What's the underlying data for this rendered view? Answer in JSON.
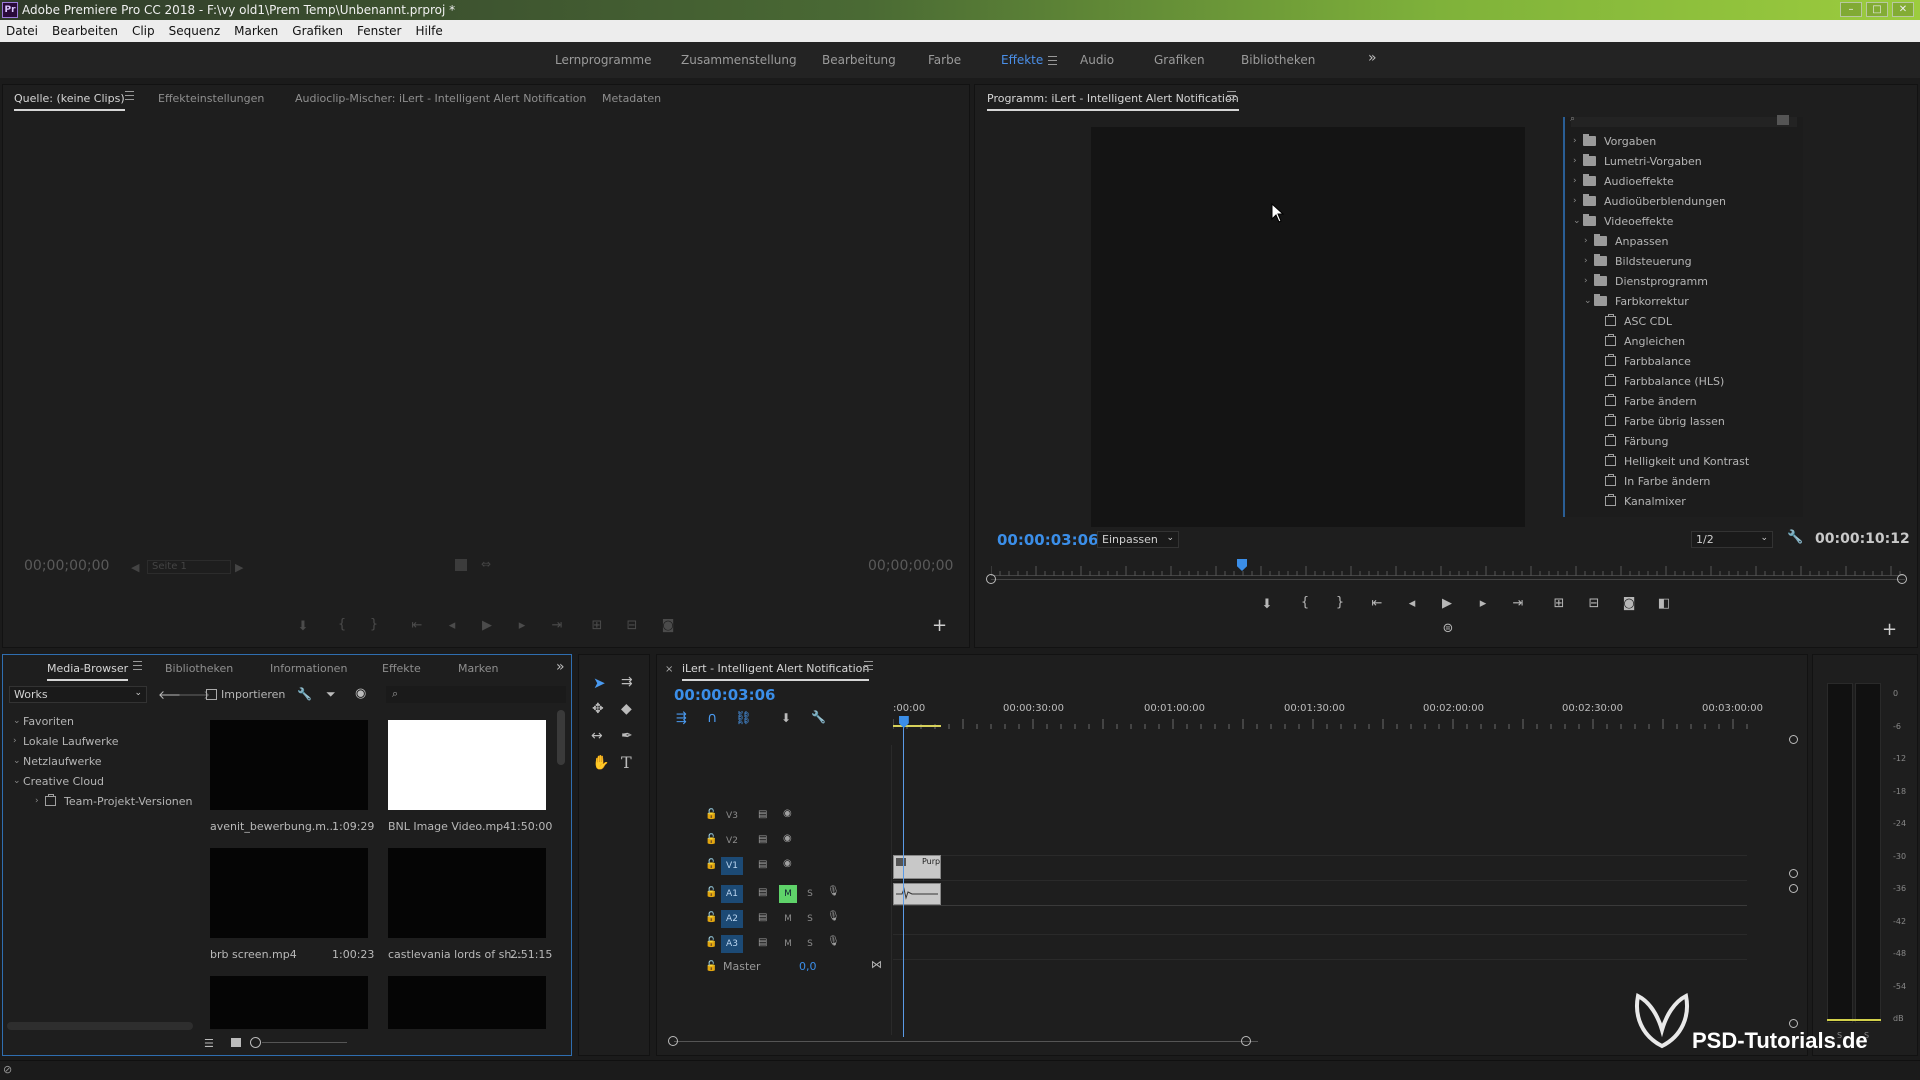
{
  "app": {
    "logo": "Pr",
    "title": "Adobe Premiere Pro CC 2018 - F:\\vy old1\\Prem Temp\\Unbenannt.prproj *",
    "window_buttons": [
      "–",
      "□",
      "✕"
    ]
  },
  "menu": [
    "Datei",
    "Bearbeiten",
    "Clip",
    "Sequenz",
    "Marken",
    "Grafiken",
    "Fenster",
    "Hilfe"
  ],
  "workspaces": {
    "tabs": [
      "Lernprogramme",
      "Zusammenstellung",
      "Bearbeitung",
      "Farbe",
      "Effekte",
      "Audio",
      "Grafiken",
      "Bibliotheken"
    ],
    "active": "Effekte",
    "overflow": "»"
  },
  "source_panel": {
    "tabs": [
      "Quelle: (keine Clips)",
      "Effekteinstellungen",
      "Audioclip-Mischer: iLert - Intelligent Alert Notification",
      "Metadaten"
    ],
    "timecode_in": "00;00;00;00",
    "timecode_out": "00;00;00;00",
    "page_label": "Seite 1",
    "add_button": "+"
  },
  "program_panel": {
    "title": "Programm: iLert - Intelligent Alert Notification",
    "timecode": "00:00:03:06",
    "fit": "Einpassen",
    "resolution": "1/2",
    "duration": "00:00:10:12",
    "add_button": "+"
  },
  "effects_tree": [
    {
      "label": "Vorgaben",
      "type": "folder",
      "level": 0,
      "expanded": false
    },
    {
      "label": "Lumetri-Vorgaben",
      "type": "folder",
      "level": 0,
      "expanded": false
    },
    {
      "label": "Audioeffekte",
      "type": "folder",
      "level": 0,
      "expanded": false
    },
    {
      "label": "Audioüberblendungen",
      "type": "folder",
      "level": 0,
      "expanded": false
    },
    {
      "label": "Videoeffekte",
      "type": "folder",
      "level": 0,
      "expanded": true
    },
    {
      "label": "Anpassen",
      "type": "folder",
      "level": 1,
      "expanded": false
    },
    {
      "label": "Bildsteuerung",
      "type": "folder",
      "level": 1,
      "expanded": false
    },
    {
      "label": "Dienstprogramm",
      "type": "folder",
      "level": 1,
      "expanded": false
    },
    {
      "label": "Farbkorrektur",
      "type": "folder",
      "level": 1,
      "expanded": true
    },
    {
      "label": "ASC CDL",
      "type": "effect",
      "level": 2
    },
    {
      "label": "Angleichen",
      "type": "effect",
      "level": 2
    },
    {
      "label": "Farbbalance",
      "type": "effect",
      "level": 2
    },
    {
      "label": "Farbbalance (HLS)",
      "type": "effect",
      "level": 2
    },
    {
      "label": "Farbe ändern",
      "type": "effect",
      "level": 2
    },
    {
      "label": "Farbe übrig lassen",
      "type": "effect",
      "level": 2
    },
    {
      "label": "Färbung",
      "type": "effect",
      "level": 2
    },
    {
      "label": "Helligkeit und Kontrast",
      "type": "effect",
      "level": 2
    },
    {
      "label": "In Farbe ändern",
      "type": "effect",
      "level": 2
    },
    {
      "label": "Kanalmixer",
      "type": "effect",
      "level": 2
    }
  ],
  "media_browser": {
    "tabs": [
      "Media-Browser",
      "Bibliotheken",
      "Informationen",
      "Effekte",
      "Marken"
    ],
    "overflow": "»",
    "location": "Works",
    "import_label": "Importieren",
    "tree": [
      {
        "label": "Favoriten",
        "expanded": true,
        "level": 0
      },
      {
        "label": "Lokale Laufwerke",
        "expanded": false,
        "level": 0
      },
      {
        "label": "Netzlaufwerke",
        "expanded": true,
        "level": 0
      },
      {
        "label": "Creative Cloud",
        "expanded": true,
        "level": 0
      },
      {
        "label": "Team-Projekt-Versionen",
        "expanded": false,
        "level": 1
      }
    ],
    "clips": [
      {
        "name": "avenit_bewerbung.m...",
        "duration": "1:09:29",
        "thumb": "#050505"
      },
      {
        "name": "BNL Image Video.mp4",
        "duration": "1:50:00",
        "thumb": "#ffffff"
      },
      {
        "name": "brb screen.mp4",
        "duration": "1:00:23",
        "thumb": "#050505"
      },
      {
        "name": "castlevania lords of sh...",
        "duration": "2:51:15",
        "thumb": "#050505"
      },
      {
        "name": "",
        "duration": "",
        "thumb": "#050505"
      },
      {
        "name": "",
        "duration": "",
        "thumb": "#050505"
      }
    ]
  },
  "timeline": {
    "title": "iLert - Intelligent Alert Notification",
    "timecode": "00:00:03:06",
    "ruler": [
      ":00:00",
      "00:00:30:00",
      "00:01:00:00",
      "00:01:30:00",
      "00:02:00:00",
      "00:02:30:00",
      "00:03:00:00"
    ],
    "video_tracks": [
      "V3",
      "V2",
      "V1"
    ],
    "audio_tracks": [
      "A1",
      "A2",
      "A3"
    ],
    "master_label": "Master",
    "master_value": "0,0",
    "clip_label": "Purp",
    "mute": "M",
    "solo": "S",
    "playhead_fraction": 0.015
  },
  "meter": {
    "ticks": [
      "0",
      "-6",
      "-12",
      "-18",
      "-24",
      "-30",
      "-36",
      "-42",
      "-48",
      "-54",
      "dB"
    ],
    "channels": [
      "S",
      "S"
    ]
  },
  "watermark": "PSD-Tutorials.de",
  "colors": {
    "accent": "#3b8ee8",
    "active_track": "#1c4a75",
    "mute_on": "#5fd36a",
    "playhead": "#5a9ae6"
  }
}
